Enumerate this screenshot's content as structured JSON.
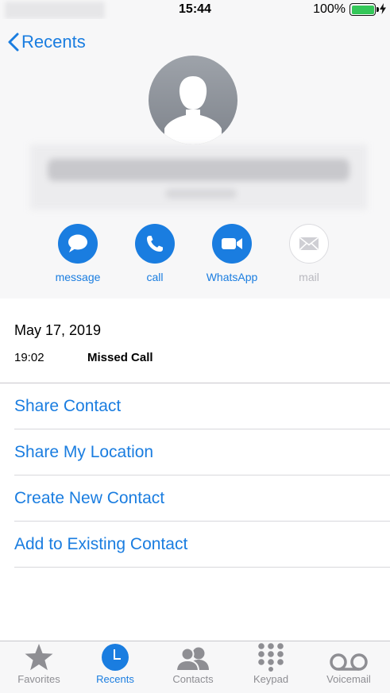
{
  "status_bar": {
    "time": "15:44",
    "battery_percent": "100%"
  },
  "header": {
    "back_label": "Recents"
  },
  "actions": [
    {
      "id": "message",
      "label": "message",
      "icon": "message-icon",
      "enabled": true
    },
    {
      "id": "call",
      "label": "call",
      "icon": "phone-icon",
      "enabled": true
    },
    {
      "id": "whatsapp",
      "label": "WhatsApp",
      "icon": "video-icon",
      "enabled": true
    },
    {
      "id": "mail",
      "label": "mail",
      "icon": "mail-icon",
      "enabled": false
    }
  ],
  "recent": {
    "date": "May 17, 2019",
    "time": "19:02",
    "type": "Missed Call"
  },
  "options": [
    {
      "label": "Share Contact"
    },
    {
      "label": "Share My Location"
    },
    {
      "label": "Create New Contact"
    },
    {
      "label": "Add to Existing Contact"
    }
  ],
  "tabs": [
    {
      "label": "Favorites",
      "icon": "star-icon",
      "active": false
    },
    {
      "label": "Recents",
      "icon": "clock-icon",
      "active": true
    },
    {
      "label": "Contacts",
      "icon": "contacts-icon",
      "active": false
    },
    {
      "label": "Keypad",
      "icon": "keypad-icon",
      "active": false
    },
    {
      "label": "Voicemail",
      "icon": "voicemail-icon",
      "active": false
    }
  ],
  "colors": {
    "accent": "#1a7de0",
    "inactive": "#8e8e93",
    "battery": "#34c759",
    "background_header": "#f7f7f8"
  }
}
